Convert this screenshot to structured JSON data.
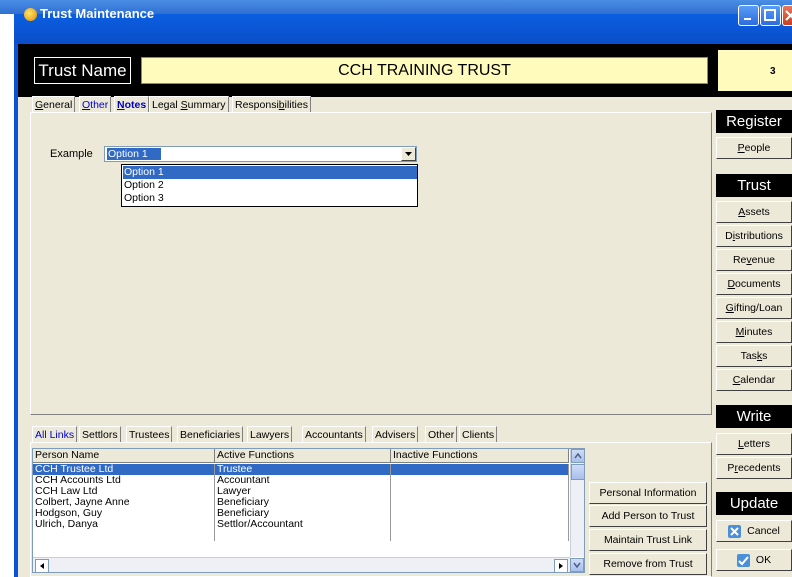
{
  "window": {
    "title": "Trust Maintenance"
  },
  "header": {
    "name_label": "Trust Name",
    "name_value": "CCH TRAINING TRUST",
    "count": "3"
  },
  "top_tabs": [
    "General",
    "Other",
    "Notes",
    "Legal Summary",
    "Responsibilities"
  ],
  "example": {
    "label": "Example",
    "selected": "Option 1",
    "options": [
      "Option 1",
      "Option 2",
      "Option 3"
    ]
  },
  "bottom_tabs": [
    "All Links",
    "Settlors",
    "Trustees",
    "Beneficiaries",
    "Lawyers",
    "Accountants",
    "Advisers",
    "Other",
    "Clients"
  ],
  "links_table": {
    "columns": [
      "Person Name",
      "Active Functions",
      "Inactive Functions"
    ],
    "rows": [
      [
        "CCH Trustee Ltd",
        "Trustee",
        ""
      ],
      [
        "CCH Accounts Ltd",
        "Accountant",
        ""
      ],
      [
        "CCH Law Ltd",
        "Lawyer",
        ""
      ],
      [
        "Colbert, Jayne Anne",
        "Beneficiary",
        ""
      ],
      [
        "Hodgson, Guy",
        "Beneficiary",
        ""
      ],
      [
        "Ulrich, Danya",
        "Settlor/Accountant",
        ""
      ]
    ]
  },
  "link_actions": [
    "Personal Information",
    "Add Person to Trust",
    "Maintain Trust Link",
    "Remove from Trust"
  ],
  "sidebar": {
    "register_header": "Register",
    "register_items": [
      "People"
    ],
    "trust_header": "Trust",
    "trust_items": [
      "Assets",
      "Distributions",
      "Revenue",
      "Documents",
      "Gifting/Loan",
      "Minutes",
      "Tasks",
      "Calendar"
    ],
    "write_header": "Write",
    "write_items": [
      "Letters",
      "Precedents"
    ],
    "update_header": "Update",
    "cancel_label": "Cancel",
    "ok_label": "OK"
  },
  "colors": {
    "title_bar": "#0a5fe0",
    "name_value_bg": "#fffbbd",
    "selection": "#316ac5"
  }
}
